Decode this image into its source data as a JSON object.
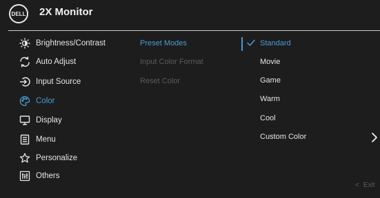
{
  "header": {
    "logo_text": "DELL",
    "title": "2X Monitor"
  },
  "menu": {
    "items": [
      {
        "label": "Brightness/Contrast",
        "icon": "brightness-icon",
        "active": false
      },
      {
        "label": "Auto Adjust",
        "icon": "auto-adjust-icon",
        "active": false
      },
      {
        "label": "Input Source",
        "icon": "input-source-icon",
        "active": false
      },
      {
        "label": "Color",
        "icon": "color-icon",
        "active": true
      },
      {
        "label": "Display",
        "icon": "display-icon",
        "active": false
      },
      {
        "label": "Menu",
        "icon": "menu-icon",
        "active": false
      },
      {
        "label": "Personalize",
        "icon": "star-icon",
        "active": false
      },
      {
        "label": "Others",
        "icon": "others-icon",
        "active": false
      }
    ]
  },
  "submenu": {
    "items": [
      {
        "label": "Preset Modes",
        "active": true
      },
      {
        "label": "Input Color Format",
        "active": false
      },
      {
        "label": "Reset Color",
        "active": false
      }
    ]
  },
  "options": {
    "items": [
      {
        "label": "Standard",
        "selected": true
      },
      {
        "label": "Movie",
        "selected": false
      },
      {
        "label": "Game",
        "selected": false
      },
      {
        "label": "Warm",
        "selected": false
      },
      {
        "label": "Cool",
        "selected": false
      },
      {
        "label": "Custom Color",
        "selected": false,
        "has_submenu": true
      }
    ]
  },
  "footer": {
    "exit_label": "Exit"
  },
  "colors": {
    "accent": "#4a9cd6",
    "background": "#1d1d1d",
    "text": "#e6e6e6",
    "disabled": "#5b5b5b"
  }
}
